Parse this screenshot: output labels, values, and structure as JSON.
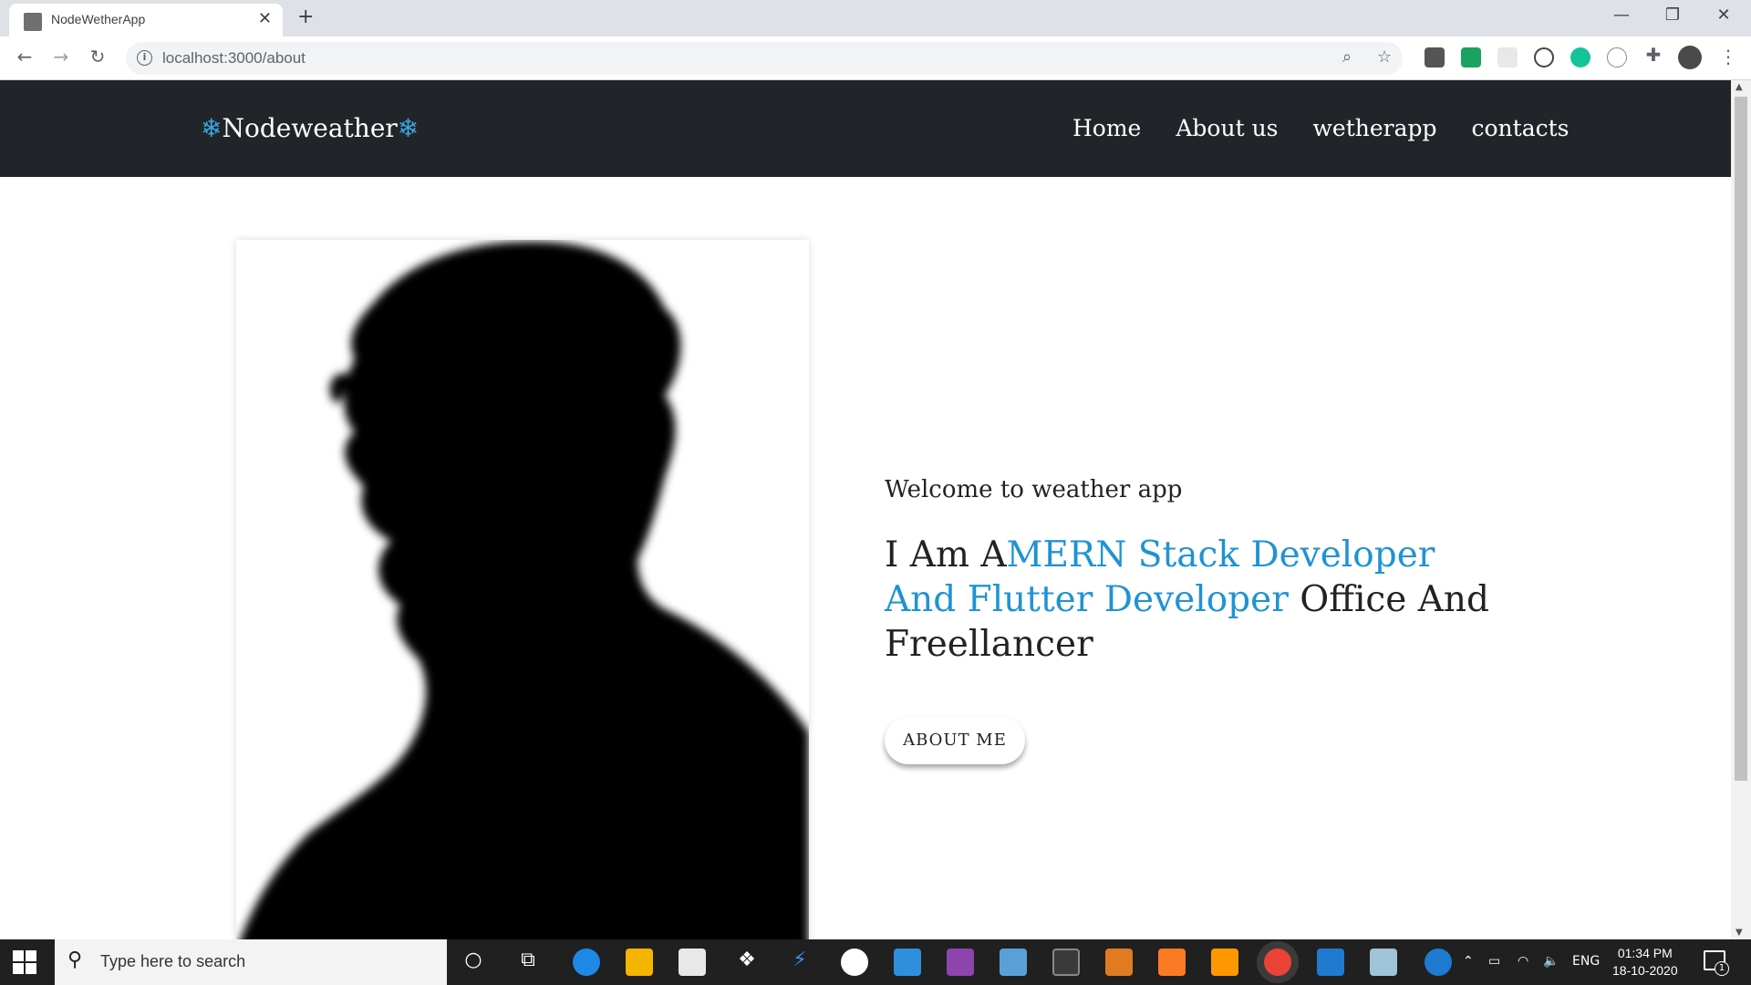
{
  "browser": {
    "tab_title": "NodeWetherApp",
    "close_tab": "✕",
    "new_tab": "+",
    "url": "localhost:3000/about",
    "window_controls": {
      "minimize": "—",
      "restore": "❐",
      "close": "✕"
    }
  },
  "site": {
    "brand": {
      "snow_left": "❄",
      "name": "Nodeweather",
      "snow_right": "❄"
    },
    "nav": [
      "Home",
      "About us",
      "wetherapp",
      "contacts"
    ],
    "welcome": "Welcome to weather app",
    "headline": {
      "prefix": "I Am A",
      "accent": "MERN Stack Developer And Flutter Developer",
      "suffix": " Office And Freellancer"
    },
    "button": "ABOUT ME",
    "accent_color": "#1f93d3",
    "navbar_color": "#212529"
  },
  "taskbar": {
    "search_placeholder": "Type here to search",
    "language": "ENG",
    "time": "01:34 PM",
    "date": "18-10-2020",
    "notifications": "1"
  }
}
